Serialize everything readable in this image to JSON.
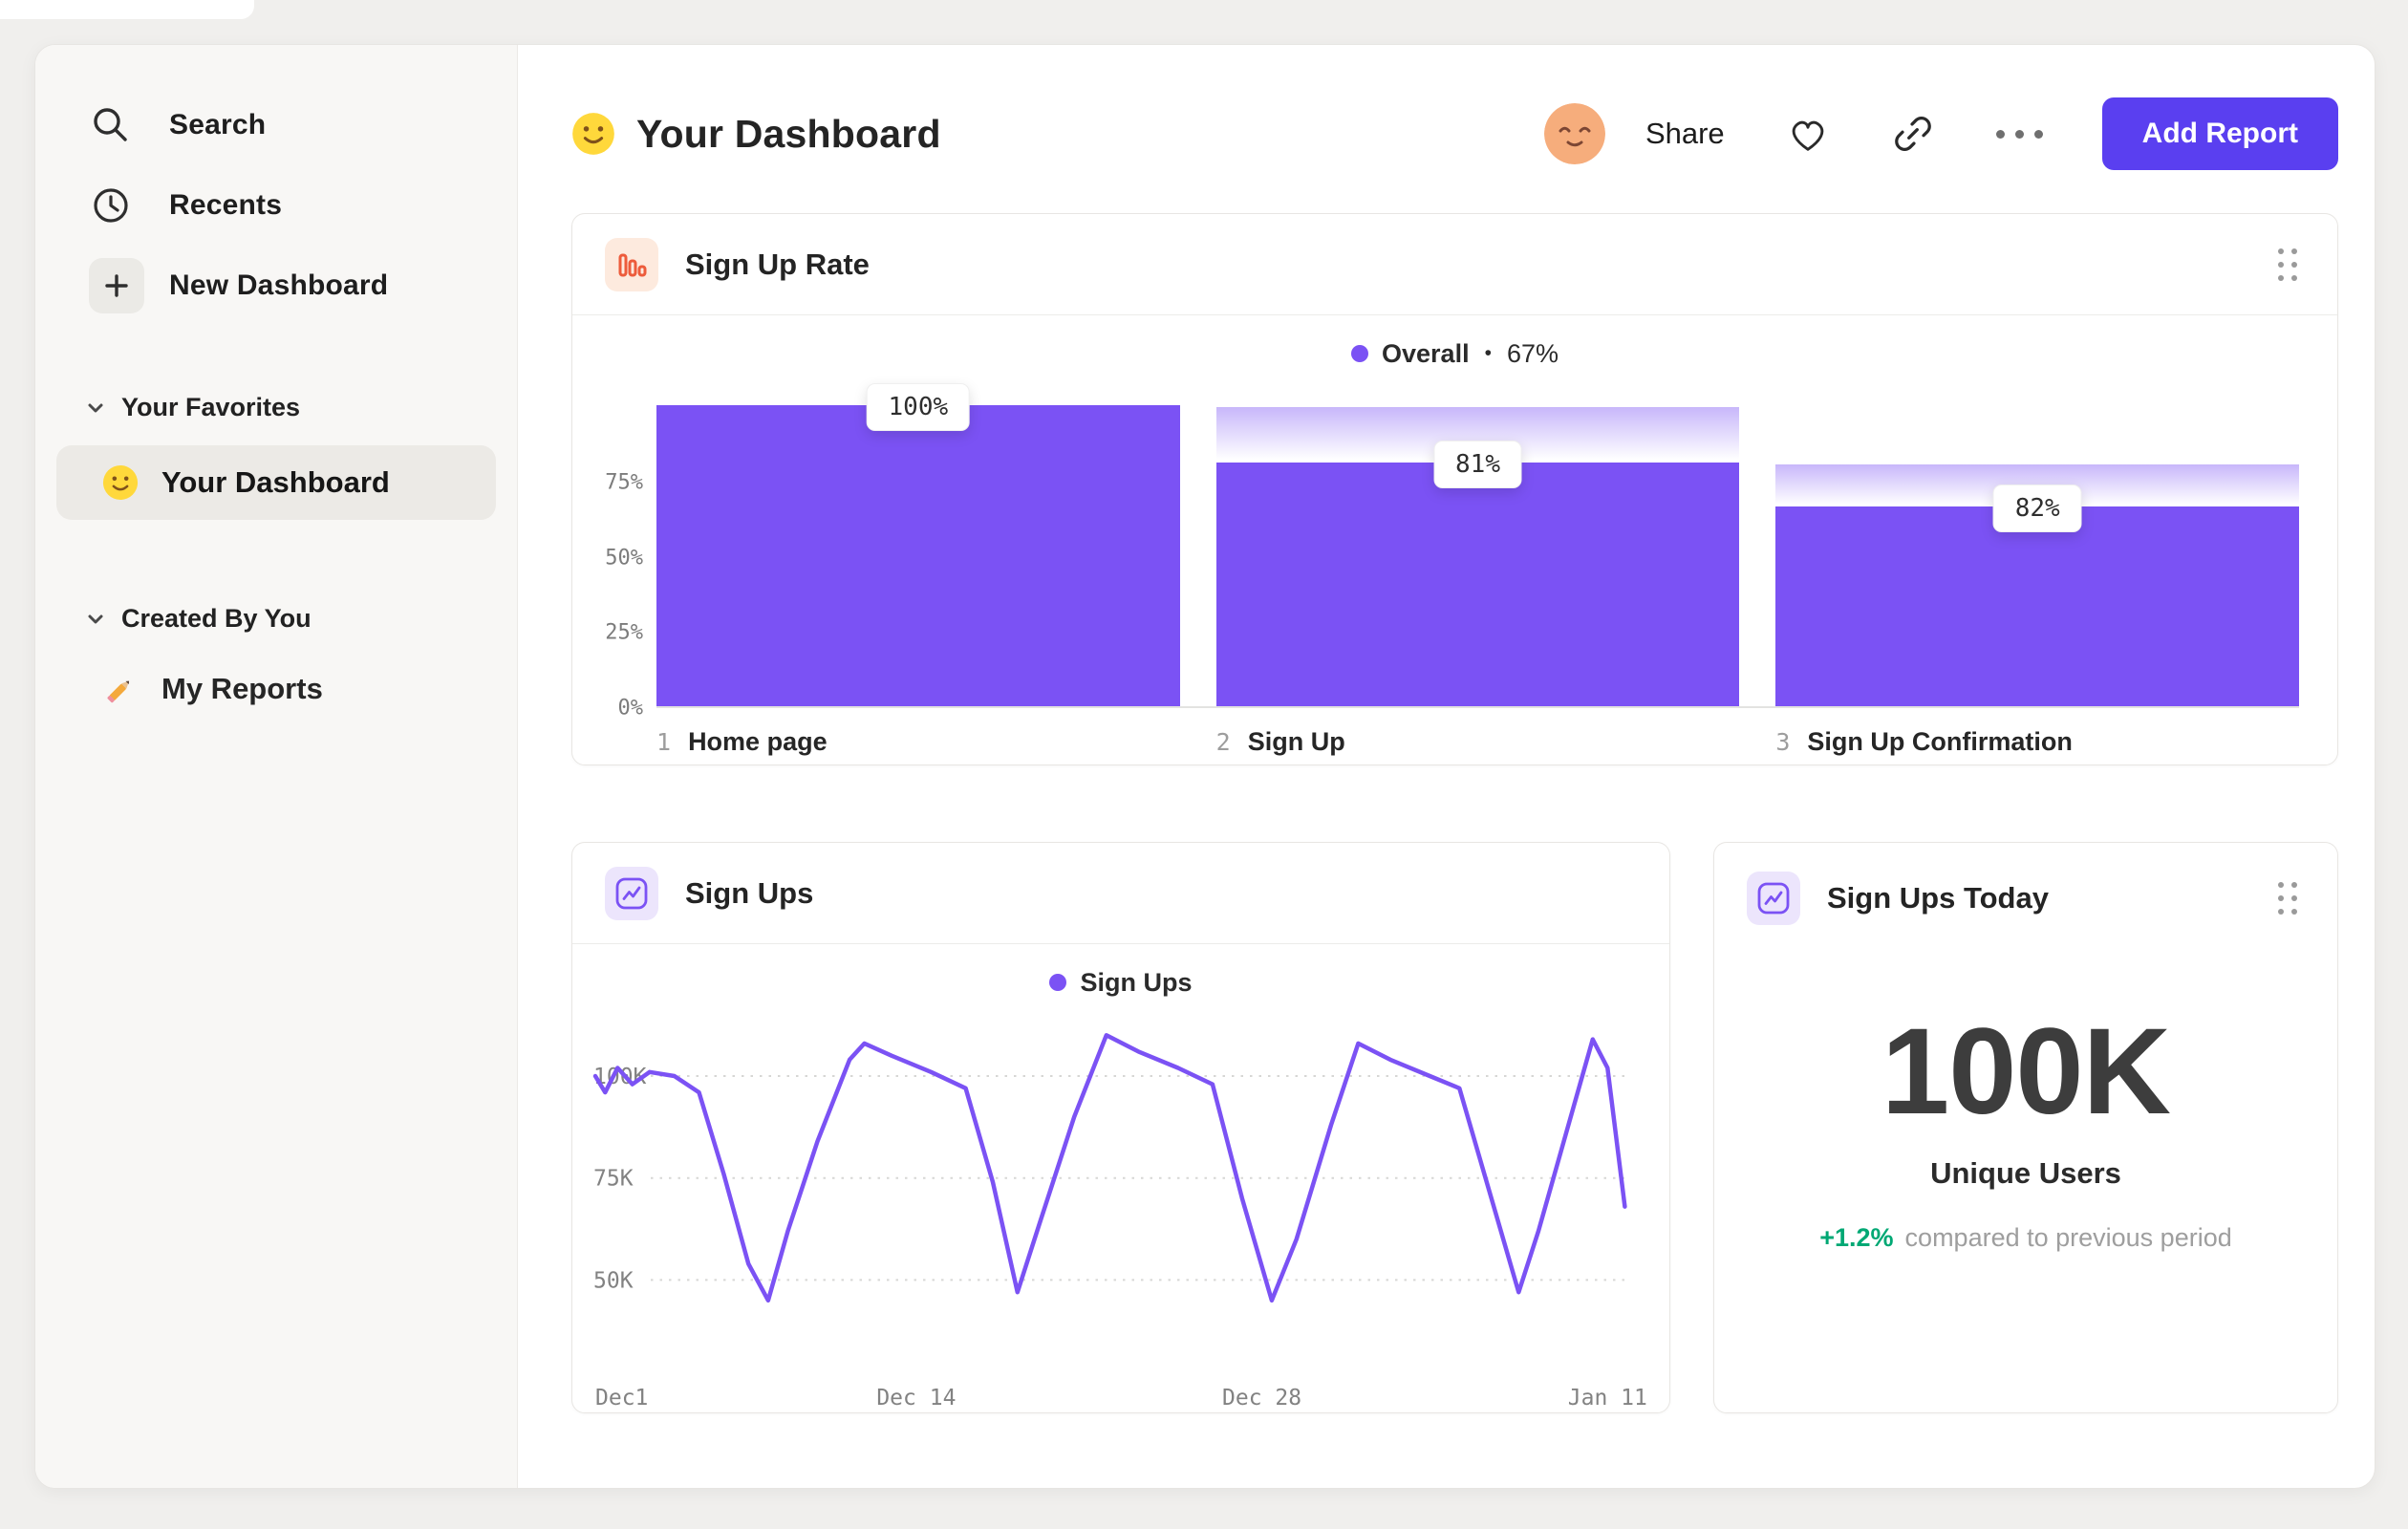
{
  "colors": {
    "purple": "#7B52F4",
    "button_purple": "#5A3FF0",
    "orange": "#ED5B3B",
    "green": "#00A874"
  },
  "sidebar": {
    "nav": [
      {
        "icon": "search-icon",
        "label": "Search"
      },
      {
        "icon": "recents-clock-icon",
        "label": "Recents"
      },
      {
        "icon": "plus-icon",
        "label": "New Dashboard"
      }
    ],
    "sections": [
      {
        "title": "Your Favorites",
        "items": [
          {
            "icon": "smiley-emoji-icon",
            "label": "Your Dashboard",
            "selected": true
          }
        ]
      },
      {
        "title": "Created By You",
        "items": [
          {
            "icon": "pencil-emoji-icon",
            "label": "My Reports",
            "selected": false
          }
        ]
      }
    ]
  },
  "header": {
    "emoji_icon": "smiley-emoji-icon",
    "title": "Your Dashboard",
    "share_label": "Share",
    "add_report_label": "Add Report"
  },
  "funnel_card": {
    "icon": "funnel-report-icon",
    "title": "Sign Up Rate",
    "legend_name": "Overall",
    "legend_sep": "•",
    "legend_value": "67%"
  },
  "line_card": {
    "icon": "line-chart-report-icon",
    "title": "Sign Ups",
    "legend_name": "Sign Ups"
  },
  "big_number_card": {
    "icon": "line-chart-report-icon",
    "title": "Sign Ups Today",
    "value": "100K",
    "subtitle": "Unique Users",
    "delta": "+1.2%",
    "delta_caption": "compared to previous period"
  },
  "chart_data": [
    {
      "type": "bar",
      "subtype": "funnel",
      "title": "Sign Up Rate",
      "legend": {
        "name": "Overall",
        "value": "67%"
      },
      "ylim": [
        0,
        100
      ],
      "yticks": [
        {
          "label": "75%",
          "value": 75
        },
        {
          "label": "50%",
          "value": 50
        },
        {
          "label": "25%",
          "value": 25
        },
        {
          "label": "0%",
          "value": 0
        }
      ],
      "steps": [
        {
          "index": "1",
          "category": "Home page",
          "value_label": "100%",
          "step_conversion_pct": 100,
          "cumulative_pct": 100,
          "prev_cumulative_pct": 100
        },
        {
          "index": "2",
          "category": "Sign Up",
          "value_label": "81%",
          "step_conversion_pct": 81,
          "cumulative_pct": 81,
          "prev_cumulative_pct": 100
        },
        {
          "index": "3",
          "category": "Sign Up Confirmation",
          "value_label": "82%",
          "step_conversion_pct": 82,
          "cumulative_pct": 66.4,
          "prev_cumulative_pct": 81
        }
      ]
    },
    {
      "type": "line",
      "title": "Sign Ups",
      "legend": {
        "name": "Sign Ups"
      },
      "x_unit": "days since Dec 1",
      "ylim": [
        18,
        115
      ],
      "xlim": [
        0,
        41.8
      ],
      "grid": "horizontal-dotted",
      "legend_position": "top-center",
      "yticks": [
        {
          "label": "100K",
          "value": 100
        },
        {
          "label": "75K",
          "value": 75
        },
        {
          "label": "50K",
          "value": 50
        }
      ],
      "xticks": [
        {
          "label": "Dec1",
          "x": 0
        },
        {
          "label": "Dec 14",
          "x": 13
        },
        {
          "label": "Dec 28",
          "x": 27
        },
        {
          "label": "Jan 11",
          "x": 41
        }
      ],
      "series": [
        {
          "name": "Sign Ups",
          "unit": "K",
          "points": [
            [
              0,
              100
            ],
            [
              0.4,
              96
            ],
            [
              0.9,
              102
            ],
            [
              1.5,
              98
            ],
            [
              2.2,
              101
            ],
            [
              3.2,
              100
            ],
            [
              4.2,
              96
            ],
            [
              5.2,
              76
            ],
            [
              6.2,
              54
            ],
            [
              7,
              45
            ],
            [
              7.8,
              62
            ],
            [
              9,
              84
            ],
            [
              10.3,
              104
            ],
            [
              10.9,
              108
            ],
            [
              12,
              105
            ],
            [
              13.6,
              101
            ],
            [
              15,
              97
            ],
            [
              16.1,
              74
            ],
            [
              17.1,
              47
            ],
            [
              18,
              64
            ],
            [
              19.4,
              90
            ],
            [
              20.7,
              110
            ],
            [
              22,
              106
            ],
            [
              23.6,
              102
            ],
            [
              25,
              98
            ],
            [
              26.2,
              70
            ],
            [
              27.4,
              45
            ],
            [
              28.4,
              60
            ],
            [
              29.8,
              88
            ],
            [
              30.9,
              108
            ],
            [
              32.2,
              104
            ],
            [
              33.8,
              100
            ],
            [
              35,
              97
            ],
            [
              36.2,
              72
            ],
            [
              37.4,
              47
            ],
            [
              38.2,
              62
            ],
            [
              39.6,
              92
            ],
            [
              40.4,
              109
            ],
            [
              41,
              102
            ],
            [
              41.7,
              68
            ]
          ]
        }
      ]
    },
    {
      "type": "big-number",
      "title": "Sign Ups Today",
      "value": "100K",
      "label": "Unique Users",
      "delta": "+1.2%",
      "delta_direction": "up",
      "comparison": "compared to previous period"
    }
  ]
}
